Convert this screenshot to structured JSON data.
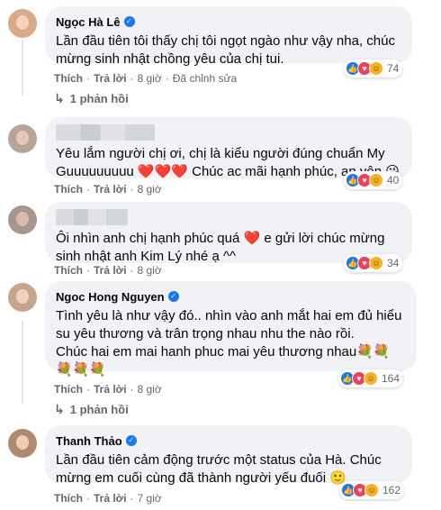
{
  "comments": [
    {
      "name": "Ngọc Hà Lê",
      "verified": true,
      "text": "Lần đầu tiên tôi thấy chị tôi ngọt ngào như vậy nha, chúc\nmừng sinh nhật chồng yêu của chị tui.",
      "like": "Thích",
      "reply": "Trả lời",
      "time": "8 giờ",
      "edited": "Đã chỉnh sửa",
      "reactions_count": "74",
      "replies_label": "1 phản hồi"
    },
    {
      "name": "",
      "verified": false,
      "text": "Yêu lắm người chị ơi, chị là kiểu người đúng chuẩn My\nGuuuuuuuuu ❤️❤️❤️ Chúc ac mãi hạnh phúc, an yên 😘",
      "like": "Thích",
      "reply": "Trả lời",
      "time": "8 giờ",
      "reactions_count": "40"
    },
    {
      "name": "",
      "verified": false,
      "text": "Ôi nhìn anh chị hạnh phúc quá ❤️ e gửi lời chúc mừng\nsinh nhật anh Kim Lý nhé ạ ^^",
      "like": "Thích",
      "reply": "Trả lời",
      "time": "8 giờ",
      "reactions_count": "34"
    },
    {
      "name": "Ngoc Hong Nguyen",
      "verified": true,
      "text": "Tình yêu là như vậy đó.. nhìn vào anh mắt hai em đủ hiểu\nsu yêu thương và trân trọng nhau nhu the nào rồi.\nChúc hai em mai hanh phuc mai yêu thương nhau💐💐\n💐💐💐",
      "like": "Thích",
      "reply": "Trả lời",
      "time": "8 giờ",
      "reactions_count": "164",
      "replies_label": "1 phản hồi"
    },
    {
      "name": "Thanh Thảo",
      "verified": true,
      "text": "Lần đầu tiên cảm động trước một status của Hà. Chúc\nmừng em cuối cùng đã thành người yếu đuối 🙂",
      "like": "Thích",
      "reply": "Trả lời",
      "time": "7 giờ",
      "reactions_count": "162"
    }
  ],
  "icons": {
    "like": "like-icon",
    "love": "love-icon",
    "care": "care-icon",
    "verified": "verified-badge-icon",
    "reply_arrow": "reply-arrow-icon"
  },
  "colors": {
    "bubble": "#f0f2f5",
    "meta": "#65676b",
    "like": "#1877f2",
    "love": "#f33e58",
    "care": "#f7b125"
  }
}
